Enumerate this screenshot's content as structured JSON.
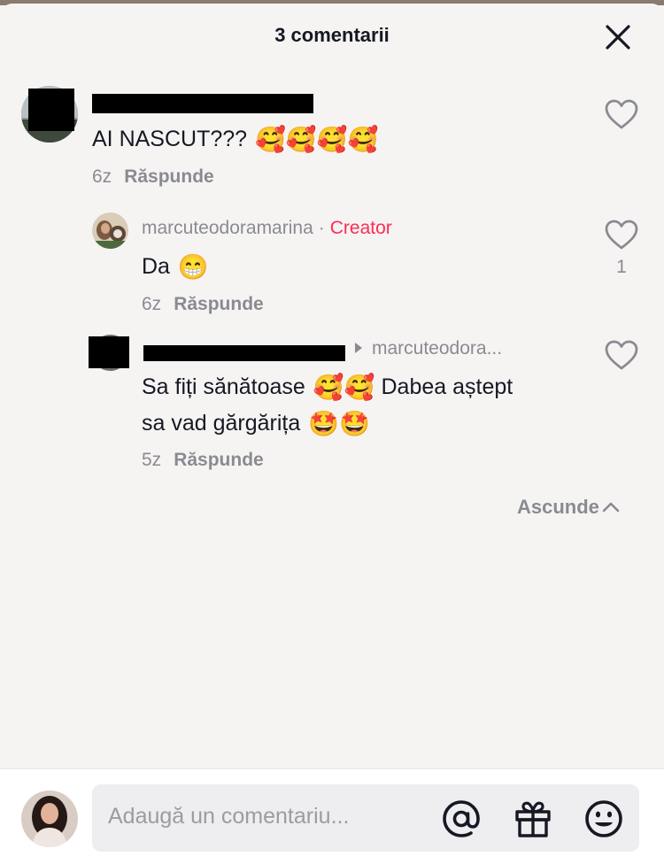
{
  "header": {
    "title": "3 comentarii",
    "close_icon": "close-icon"
  },
  "comments": [
    {
      "username": "",
      "text": "AI NASCUT???",
      "emoji": "🥰🥰🥰🥰",
      "time": "6z",
      "reply_label": "Răspunde"
    },
    {
      "username": "marcuteodoramarina",
      "badge": "Creator",
      "separator": "·",
      "text": "Da",
      "emoji": "😁",
      "time": "6z",
      "reply_label": "Răspunde",
      "likes": "1"
    },
    {
      "username": "",
      "reply_to": "marcuteodora...",
      "text_line1": "Sa fiți sănătoase",
      "emoji_line1": "🥰🥰",
      "text_line1b": "Dabea aștept",
      "text_line2": "sa vad gărgărița",
      "emoji_line2": "🤩🤩",
      "time": "5z",
      "reply_label": "Răspunde"
    }
  ],
  "hide_label": "Ascunde",
  "composer": {
    "placeholder": "Adaugă un comentariu...",
    "icons": [
      "at-icon",
      "gift-icon",
      "emoji-icon"
    ]
  },
  "colors": {
    "accent": "#fe2c55",
    "text": "#161823",
    "muted": "#8a8b91",
    "background": "#f6f4f3"
  }
}
